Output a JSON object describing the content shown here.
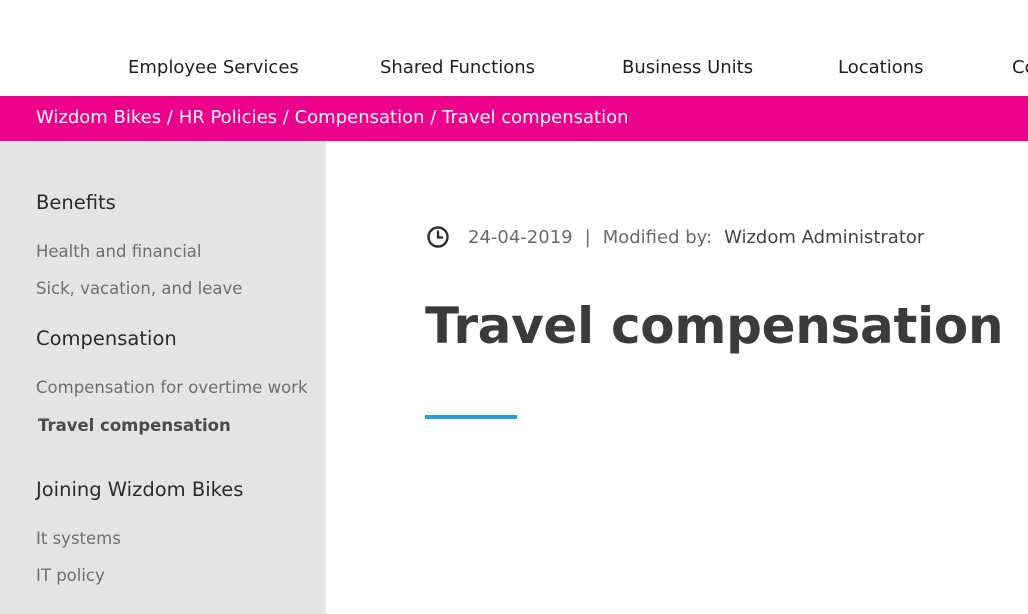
{
  "colors": {
    "brand": "#ec008c",
    "sidebar_bg": "#e4e4e4",
    "accent_underline": "#1ba1e2"
  },
  "topnav": {
    "items": [
      "Employee Services",
      "Shared Functions",
      "Business Units",
      "Locations",
      "Co"
    ]
  },
  "breadcrumb": {
    "items": [
      "Wizdom Bikes",
      "HR Policies",
      "Compensation",
      "Travel compensation"
    ],
    "separator": "/"
  },
  "sidebar": {
    "sections": [
      {
        "heading": "Benefits",
        "links": [
          "Health and financial",
          "Sick, vacation, and leave"
        ]
      },
      {
        "heading": "Compensation",
        "links": [
          "Compensation for overtime work",
          "Travel compensation"
        ],
        "active": "Travel compensation"
      },
      {
        "heading": "Joining Wizdom Bikes",
        "links": [
          "It systems",
          "IT policy"
        ]
      }
    ]
  },
  "meta": {
    "icon": "clock-icon",
    "date": "24-04-2019",
    "divider": "|",
    "modified_label": "Modified by:",
    "author": "Wizdom Administrator"
  },
  "page": {
    "title": "Travel compensation"
  }
}
